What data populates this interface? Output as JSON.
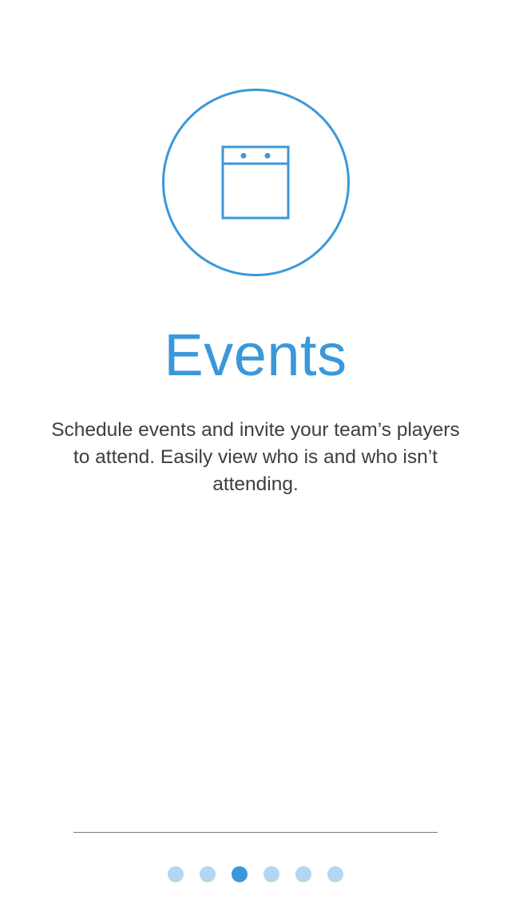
{
  "onboarding": {
    "icon": "calendar-icon",
    "title": "Events",
    "description": "Schedule events and invite your team’s players to attend. Easily view who is and who isn’t attending."
  },
  "pager": {
    "total_pages": 6,
    "current_page": 3
  },
  "colors": {
    "accent": "#3a98da",
    "dot_inactive": "#b2d7f1",
    "body_text": "#3e3e3e",
    "divider": "#7a7a7a"
  }
}
